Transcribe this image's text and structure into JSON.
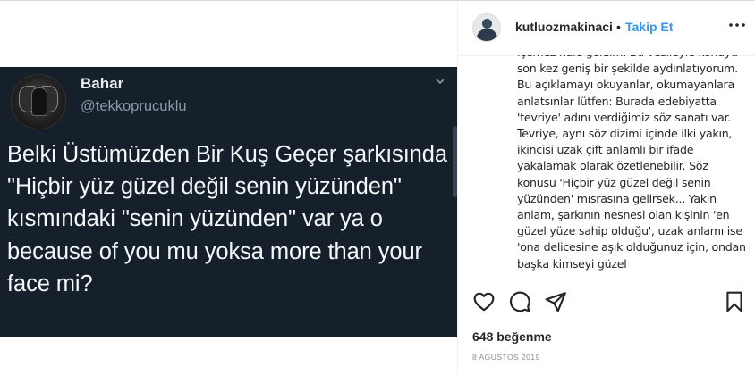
{
  "tweet": {
    "name": "Bahar",
    "handle": "@tekkoprucuklu",
    "text": "Belki Üstümüzden Bir Kuş Geçer şarkısında \"Hiçbir yüz güzel değil senin yüzünden\" kısmındaki \"senin yüzünden\" var ya o because of you mu yoksa more than your face mi?"
  },
  "post": {
    "username": "kutluozmakinaci",
    "separator": "•",
    "follow_label": "Takip Et",
    "caption": "içemez hale geldim. Bu vesileyle konuyu son kez geniş bir şekilde aydınlatıyorum. Bu açıklamayı okuyanlar, okumayanlara anlatsınlar lütfen: Burada edebiyatta 'tevriye' adını verdiğimiz söz sanatı var. Tevriye, aynı söz dizimi içinde ilki yakın, ikincisi uzak çift anlamlı bir ifade yakalamak olarak özetlenebilir. Söz konusu 'Hiçbir yüz güzel değil senin yüzünden' mısrasına gelirsek... Yakın anlam, şarkının nesnesi olan kişinin 'en güzel yüze sahip olduğu', uzak anlamı ise 'ona delicesine aşık olduğunuz için, ondan başka kimseyi güzel",
    "likes": "648 beğenme",
    "date": "8 AĞUSTOS 2019"
  },
  "icons": {
    "like": "heart-icon",
    "comment": "comment-icon",
    "share": "share-icon",
    "save": "bookmark-icon",
    "more": "more-icon",
    "tweet_menu": "chevron-down-icon"
  },
  "colors": {
    "tweet_bg": "#15202b",
    "follow": "#3897f0",
    "text": "#262626",
    "muted": "#8e8e8e"
  }
}
